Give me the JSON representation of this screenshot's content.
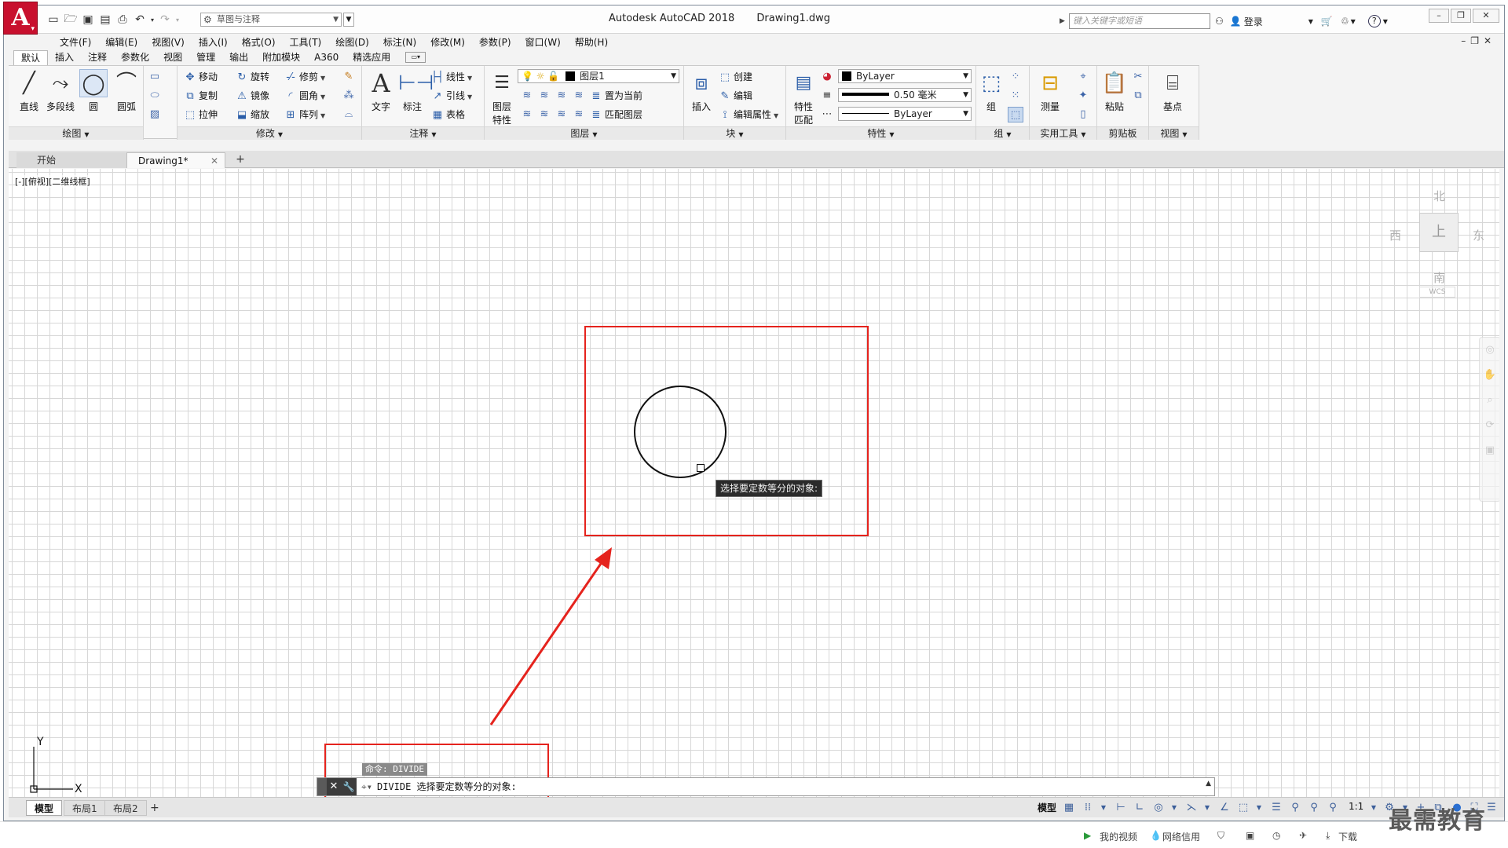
{
  "titlebar": {
    "app_name": "Autodesk AutoCAD 2018",
    "document": "Drawing1.dwg",
    "workspace": "草图与注释",
    "search_placeholder": "键入关键字或短语",
    "login": "登录",
    "help": "?"
  },
  "menubar": [
    "文件(F)",
    "编辑(E)",
    "视图(V)",
    "插入(I)",
    "格式(O)",
    "工具(T)",
    "绘图(D)",
    "标注(N)",
    "修改(M)",
    "参数(P)",
    "窗口(W)",
    "帮助(H)"
  ],
  "ribbon_tabs": [
    "默认",
    "插入",
    "注释",
    "参数化",
    "视图",
    "管理",
    "输出",
    "附加模块",
    "A360",
    "精选应用"
  ],
  "panels": {
    "draw": {
      "title": "绘图",
      "line": "直线",
      "polyline": "多段线",
      "circle": "圆",
      "arc": "圆弧"
    },
    "modify": {
      "title": "修改",
      "move": "移动",
      "rotate": "旋转",
      "trim": "修剪",
      "copy": "复制",
      "mirror": "镜像",
      "fillet": "圆角",
      "stretch": "拉伸",
      "scale": "缩放",
      "array": "阵列"
    },
    "annotation": {
      "title": "注释",
      "text": "文字",
      "dimension": "标注",
      "linear": "线性",
      "leader": "引线",
      "table": "表格"
    },
    "layers": {
      "title": "图层",
      "properties_line1": "图层",
      "properties_line2": "特性",
      "current_layer": "图层1",
      "set_current": "置为当前",
      "match_layer": "匹配图层"
    },
    "block": {
      "title": "块",
      "insert": "插入",
      "create": "创建",
      "edit": "编辑",
      "edit_attr": "编辑属性"
    },
    "properties": {
      "title": "特性",
      "match_line1": "特性",
      "match_line2": "匹配",
      "color": "ByLayer",
      "lineweight": "0.50 毫米",
      "linetype": "ByLayer"
    },
    "groups": {
      "title": "组",
      "group": "组"
    },
    "utilities": {
      "title": "实用工具",
      "measure": "测量"
    },
    "clipboard": {
      "title": "剪贴板",
      "paste": "粘贴"
    },
    "view": {
      "title": "视图",
      "base": "基点"
    }
  },
  "file_tabs": {
    "start": "开始",
    "drawing": "Drawing1*"
  },
  "canvas": {
    "view_label": "[-][俯视][二维线框]",
    "tooltip": "选择要定数等分的对象:",
    "viewcube": {
      "north": "北",
      "south": "南",
      "east": "东",
      "west": "西",
      "top": "上",
      "wcs": "WCS"
    },
    "ucs": {
      "x": "X",
      "y": "Y"
    }
  },
  "command": {
    "history": "命令: DIVIDE",
    "prompt": "DIVIDE 选择要定数等分的对象:"
  },
  "layout_tabs": [
    "模型",
    "布局1",
    "布局2"
  ],
  "status": {
    "model": "模型",
    "scale": "1:1"
  },
  "bottombar": {
    "video": "我的视频",
    "network": "网络信用",
    "download": "下载"
  },
  "watermark": "最需教育",
  "colors": {
    "highlight": "#e5231d",
    "logo": "#c8102e",
    "tooltip_bg": "#2b2b2b"
  }
}
